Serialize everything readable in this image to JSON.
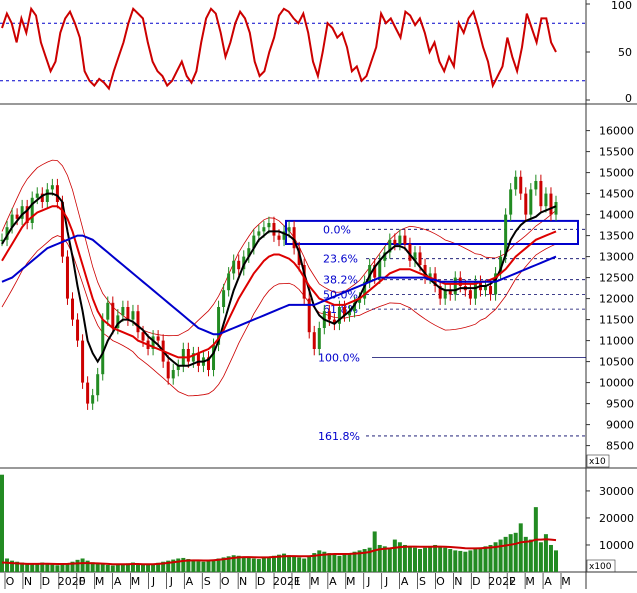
{
  "chart_data": [
    {
      "type": "line",
      "panel": "oscillator",
      "y_ticks": [
        "100",
        "50",
        "0"
      ],
      "ylim": [
        0,
        100
      ],
      "reference_lines": [
        80,
        20
      ],
      "series": [
        {
          "color": "#cc0000",
          "values": [
            75,
            90,
            80,
            60,
            85,
            70,
            95,
            88,
            60,
            45,
            30,
            40,
            70,
            85,
            92,
            80,
            65,
            30,
            20,
            15,
            22,
            18,
            12,
            30,
            45,
            60,
            80,
            95,
            90,
            85,
            60,
            40,
            30,
            25,
            15,
            20,
            30,
            40,
            25,
            18,
            30,
            60,
            85,
            95,
            90,
            70,
            45,
            60,
            80,
            92,
            85,
            70,
            40,
            25,
            30,
            50,
            65,
            88,
            95,
            92,
            85,
            80,
            90,
            70,
            40,
            25,
            50,
            80,
            75,
            65,
            70,
            55,
            30,
            35,
            20,
            25,
            40,
            55,
            90,
            80,
            85,
            75,
            65,
            92,
            88,
            78,
            85,
            70,
            50,
            60,
            40,
            30,
            45,
            35,
            80,
            70,
            85,
            92,
            75,
            55,
            40,
            15,
            25,
            35,
            65,
            45,
            30,
            55,
            90,
            75,
            60,
            85,
            85,
            60,
            50
          ]
        }
      ]
    },
    {
      "type": "line",
      "panel": "price",
      "y_ticks": [
        "16000",
        "15500",
        "15000",
        "14500",
        "14000",
        "13500",
        "13000",
        "12500",
        "12000",
        "11500",
        "11000",
        "10500",
        "10000",
        "9500",
        "9000",
        "8500"
      ],
      "ylim": [
        8300,
        16300
      ],
      "scale_note": "x10",
      "x_ticks": [
        "O",
        "N",
        "D",
        "2020",
        "F",
        "M",
        "A",
        "M",
        "J",
        "J",
        "A",
        "S",
        "O",
        "N",
        "D",
        "2021",
        "F",
        "M",
        "A",
        "M",
        "J",
        "J",
        "A",
        "S",
        "O",
        "N",
        "D",
        "2022",
        "F",
        "M",
        "A",
        "M"
      ],
      "fibonacci": [
        {
          "label": "0.0%",
          "value": 13650
        },
        {
          "label": "23.6%",
          "value": 12950
        },
        {
          "label": "38.2%",
          "value": 12450
        },
        {
          "label": "50.0%",
          "value": 12100
        },
        {
          "label": "61.8%",
          "value": 11750
        },
        {
          "label": "100.0%",
          "value": 10600
        },
        {
          "label": "161.8%",
          "value": 8730
        }
      ],
      "highlight_zone": {
        "low": 13300,
        "high": 13850
      },
      "colors": {
        "ma_short": "#000000",
        "ma_mid": "#dd0000",
        "ma_long": "#0000cc",
        "bands": "#cc0000",
        "fib": "#0000cc",
        "up_candle": "#228b22",
        "down_candle": "#cc0000"
      },
      "series": [
        {
          "color": "#228b22",
          "values": [
            13400,
            13700,
            14000,
            13900,
            14200,
            13800,
            14400,
            14500,
            14300,
            14600,
            14700,
            14300,
            13000,
            12000,
            11500,
            11000,
            10000,
            9500,
            9700,
            10200,
            11500,
            11900,
            11300,
            11600,
            11800,
            11500,
            11700,
            11200,
            11000,
            10800,
            11100,
            11000,
            10500,
            10100,
            10300,
            10400,
            10800,
            10500,
            10700,
            10400,
            10600,
            10300,
            10900,
            11800,
            12200,
            12600,
            12900,
            12700,
            13000,
            13200,
            13500,
            13600,
            13700,
            13800,
            13500,
            13400,
            13600,
            13700,
            13200,
            12800,
            12000,
            11200,
            10800,
            11300,
            11700,
            11500,
            11400,
            11800,
            11600,
            11700,
            11900,
            12000,
            12400,
            12800,
            12500,
            12900,
            13100,
            13400,
            13300,
            13500,
            13300,
            12900,
            13100,
            12800,
            12500,
            12600,
            12300,
            12000,
            12200,
            12100,
            12500,
            12300,
            12200,
            12000,
            12400,
            12200,
            12300,
            12100,
            12600,
            13000,
            14000,
            14600,
            14900,
            14500,
            14000,
            14600,
            14800,
            14200,
            14500,
            14000,
            14300
          ]
        },
        {
          "name": "",
          "color": "#000000",
          "values": [
            13300,
            13500,
            13700,
            13850,
            14000,
            14100,
            14250,
            14350,
            14450,
            14500,
            14500,
            14450,
            14300,
            13600,
            13000,
            12300,
            11700,
            11000,
            10700,
            10500,
            10700,
            11000,
            11200,
            11400,
            11500,
            11500,
            11450,
            11350,
            11250,
            11100,
            11000,
            10900,
            10750,
            10600,
            10500,
            10400,
            10400,
            10400,
            10450,
            10500,
            10500,
            10550,
            10700,
            11000,
            11400,
            11800,
            12200,
            12500,
            12800,
            13000,
            13200,
            13400,
            13500,
            13600,
            13600,
            13600,
            13550,
            13500,
            13400,
            13100,
            12600,
            12200,
            11800,
            11600,
            11500,
            11450,
            11400,
            11500,
            11600,
            11700,
            11850,
            12050,
            12300,
            12550,
            12750,
            12900,
            13050,
            13150,
            13250,
            13250,
            13200,
            13050,
            12900,
            12750,
            12600,
            12450,
            12350,
            12250,
            12200,
            12200,
            12200,
            12250,
            12250,
            12250,
            12250,
            12300,
            12300,
            12350,
            12450,
            12700,
            13050,
            13400,
            13600,
            13750,
            13850,
            13900,
            13950,
            14050,
            14100,
            14150,
            14200
          ]
        },
        {
          "name": "",
          "color": "#dd0000",
          "values": [
            12900,
            13100,
            13300,
            13500,
            13700,
            13850,
            13950,
            14050,
            14100,
            14150,
            14200,
            14200,
            14100,
            13900,
            13600,
            13200,
            12800,
            12400,
            12000,
            11700,
            11500,
            11400,
            11300,
            11250,
            11200,
            11150,
            11100,
            11000,
            10950,
            10900,
            10850,
            10800,
            10750,
            10700,
            10650,
            10600,
            10600,
            10600,
            10650,
            10700,
            10750,
            10800,
            10900,
            11050,
            11250,
            11500,
            11750,
            12000,
            12200,
            12400,
            12600,
            12750,
            12900,
            13000,
            13050,
            13050,
            13000,
            12950,
            12850,
            12700,
            12500,
            12300,
            12150,
            12000,
            11950,
            11900,
            11850,
            11850,
            11850,
            11900,
            11950,
            12000,
            12100,
            12200,
            12300,
            12400,
            12500,
            12600,
            12650,
            12700,
            12700,
            12700,
            12650,
            12600,
            12550,
            12500,
            12450,
            12400,
            12350,
            12350,
            12350,
            12350,
            12350,
            12350,
            12350,
            12400,
            12400,
            12450,
            12500,
            12600,
            12700,
            12850,
            13000,
            13100,
            13200,
            13300,
            13400,
            13450,
            13500,
            13550,
            13600
          ]
        },
        {
          "name": "",
          "color": "#0000cc",
          "values": [
            12400,
            12450,
            12500,
            12600,
            12700,
            12800,
            12900,
            13000,
            13100,
            13200,
            13250,
            13300,
            13350,
            13400,
            13450,
            13500,
            13500,
            13450,
            13400,
            13300,
            13200,
            13100,
            13000,
            12900,
            12800,
            12700,
            12600,
            12500,
            12400,
            12300,
            12200,
            12100,
            12000,
            11900,
            11800,
            11700,
            11600,
            11500,
            11400,
            11300,
            11250,
            11200,
            11150,
            11150,
            11200,
            11250,
            11300,
            11350,
            11400,
            11450,
            11500,
            11550,
            11600,
            11650,
            11700,
            11750,
            11800,
            11850,
            11850,
            11850,
            11850,
            11850,
            11850,
            11900,
            11950,
            12000,
            12050,
            12100,
            12150,
            12200,
            12250,
            12300,
            12350,
            12400,
            12450,
            12500,
            12500,
            12500,
            12500,
            12500,
            12500,
            12500,
            12500,
            12500,
            12500,
            12450,
            12450,
            12400,
            12400,
            12400,
            12400,
            12400,
            12400,
            12400,
            12400,
            12400,
            12400,
            12400,
            12400,
            12450,
            12500,
            12550,
            12600,
            12650,
            12700,
            12750,
            12800,
            12850,
            12900,
            12950,
            13000
          ]
        }
      ]
    },
    {
      "type": "bar",
      "panel": "volume",
      "y_ticks": [
        "30000",
        "20000",
        "10000"
      ],
      "ylim": [
        0,
        37000
      ],
      "scale_note": "x100",
      "colors": {
        "bars": "#228b22",
        "average": "#cc0000"
      },
      "values": [
        36000,
        5000,
        4200,
        3800,
        3500,
        3000,
        2800,
        3200,
        3500,
        3000,
        2800,
        2500,
        3000,
        3200,
        3800,
        4500,
        5000,
        4200,
        3600,
        3000,
        2800,
        2600,
        2400,
        2800,
        3000,
        3200,
        3500,
        3000,
        2800,
        2600,
        3000,
        3400,
        3800,
        4200,
        4600,
        5000,
        5200,
        4800,
        4400,
        4000,
        3800,
        4200,
        4600,
        5000,
        5400,
        5800,
        6200,
        6000,
        5600,
        5200,
        5000,
        4800,
        5200,
        5600,
        6000,
        6400,
        6800,
        6200,
        5800,
        5400,
        5000,
        6000,
        7000,
        8000,
        7500,
        7000,
        6500,
        6000,
        6500,
        7000,
        7500,
        8000,
        8500,
        9000,
        15000,
        10000,
        9500,
        9000,
        12000,
        11000,
        10000,
        9500,
        9000,
        8500,
        9000,
        9500,
        10000,
        9500,
        9000,
        8500,
        8000,
        7800,
        7500,
        8000,
        8500,
        9000,
        9500,
        10000,
        11000,
        12000,
        13000,
        14000,
        14500,
        18000,
        13000,
        12000,
        24000,
        11000,
        14000,
        10000,
        8000
      ],
      "average": [
        3500,
        3400,
        3300,
        3200,
        3100,
        3000,
        3000,
        3000,
        3050,
        3050,
        3000,
        2950,
        2950,
        3000,
        3100,
        3200,
        3300,
        3300,
        3250,
        3200,
        3100,
        3000,
        2900,
        2850,
        2850,
        2900,
        2950,
        2950,
        2900,
        2850,
        2900,
        3000,
        3150,
        3350,
        3600,
        3850,
        4100,
        4250,
        4300,
        4300,
        4250,
        4250,
        4350,
        4500,
        4700,
        4950,
        5200,
        5400,
        5500,
        5500,
        5450,
        5400,
        5400,
        5450,
        5550,
        5700,
        5850,
        5900,
        5900,
        5850,
        5800,
        5850,
        6000,
        6250,
        6450,
        6600,
        6650,
        6650,
        6650,
        6700,
        6800,
        6950,
        7150,
        7400,
        8000,
        8400,
        8600,
        8750,
        9000,
        9200,
        9350,
        9400,
        9400,
        9350,
        9350,
        9350,
        9400,
        9400,
        9350,
        9250,
        9100,
        8950,
        8800,
        8750,
        8750,
        8800,
        8900,
        9050,
        9250,
        9500,
        9800,
        10100,
        10450,
        11000,
        11200,
        11350,
        12000,
        12000,
        12100,
        12000,
        11800
      ]
    }
  ]
}
